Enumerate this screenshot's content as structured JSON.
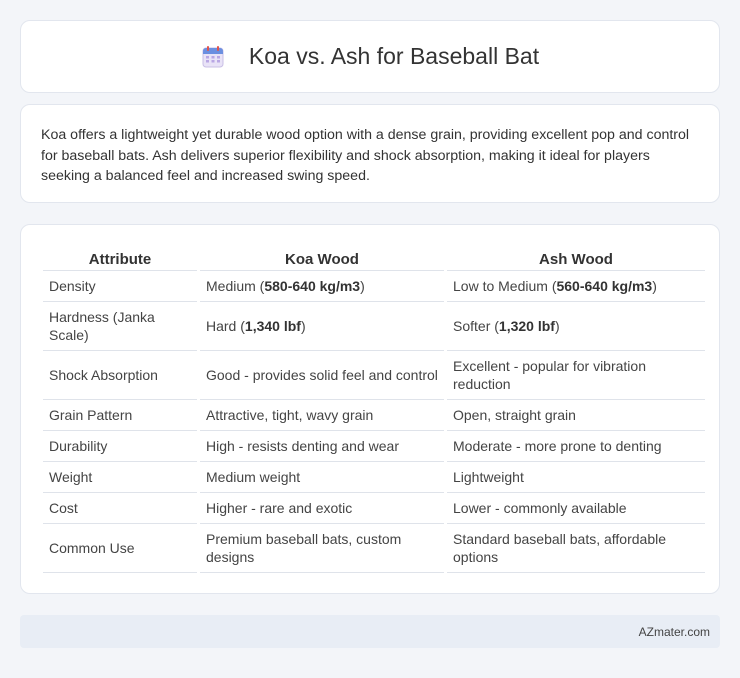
{
  "header": {
    "title": "Koa vs. Ash for Baseball Bat",
    "icon": "calendar-icon"
  },
  "intro": {
    "text": "Koa offers a lightweight yet durable wood option with a dense grain, providing excellent pop and control for baseball bats. Ash delivers superior flexibility and shock absorption, making it ideal for players seeking a balanced feel and increased swing speed."
  },
  "table": {
    "columns": [
      "Attribute",
      "Koa Wood",
      "Ash Wood"
    ],
    "rows": [
      {
        "attr": "Density",
        "koa": [
          "Medium (",
          "580-640 kg/m3",
          ")"
        ],
        "ash": [
          "Low to Medium (",
          "560-640 kg/m3",
          ")"
        ]
      },
      {
        "attr": "Hardness (Janka Scale)",
        "koa": [
          "Hard (",
          "1,340 lbf",
          ")"
        ],
        "ash": [
          "Softer (",
          "1,320 lbf",
          ")"
        ]
      },
      {
        "attr": "Shock Absorption",
        "koa": [
          "Good - provides solid feel and control"
        ],
        "ash": [
          "Excellent - popular for vibration reduction"
        ]
      },
      {
        "attr": "Grain Pattern",
        "koa": [
          "Attractive, tight, wavy grain"
        ],
        "ash": [
          "Open, straight grain"
        ]
      },
      {
        "attr": "Durability",
        "koa": [
          "High - resists denting and wear"
        ],
        "ash": [
          "Moderate - more prone to denting"
        ]
      },
      {
        "attr": "Weight",
        "koa": [
          "Medium weight"
        ],
        "ash": [
          "Lightweight"
        ]
      },
      {
        "attr": "Cost",
        "koa": [
          "Higher - rare and exotic"
        ],
        "ash": [
          "Lower - commonly available"
        ]
      },
      {
        "attr": "Common Use",
        "koa": [
          "Premium baseball bats, custom designs"
        ],
        "ash": [
          "Standard baseball bats, affordable options"
        ]
      }
    ]
  },
  "footer": {
    "brand": "AZmater.com"
  },
  "colors": {
    "background": "#f3f5f9",
    "card": "#ffffff",
    "footer": "#e8edf5"
  }
}
